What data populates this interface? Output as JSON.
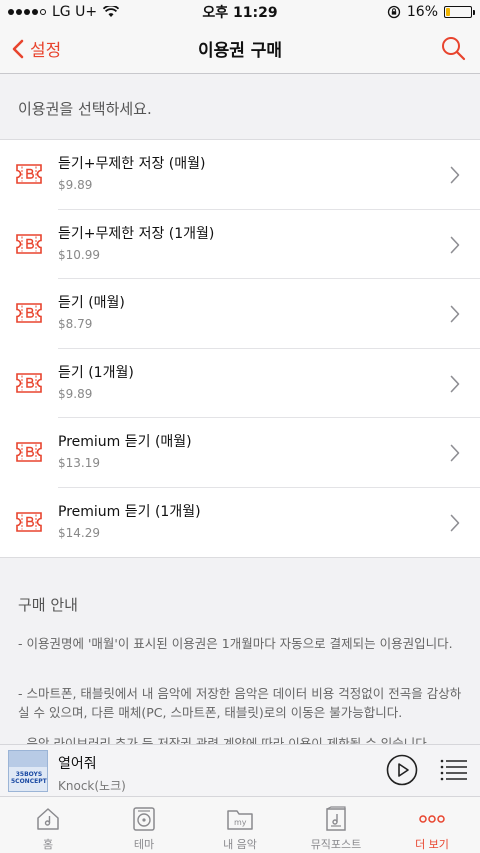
{
  "status_bar": {
    "carrier": "LG U+",
    "time": "오후 11:29",
    "battery": "16%",
    "battery_level": 0.16
  },
  "nav": {
    "back_label": "설정",
    "title": "이용권 구매"
  },
  "section_header": "이용권을 선택하세요.",
  "items": [
    {
      "title": "듣기+무제한 저장 (매월)",
      "price": "$9.89"
    },
    {
      "title": "듣기+무제한 저장 (1개월)",
      "price": "$10.99"
    },
    {
      "title": "듣기 (매월)",
      "price": "$8.79"
    },
    {
      "title": "듣기 (1개월)",
      "price": "$9.89"
    },
    {
      "title": "Premium 듣기 (매월)",
      "price": "$13.19"
    },
    {
      "title": "Premium 듣기 (1개월)",
      "price": "$14.29"
    }
  ],
  "info": {
    "title": "구매 안내",
    "lines": [
      "- 이용권명에 '매월'이 표시된 이용권은 1개월마다 자동으로 결제되는 이용권입니다.",
      "- 스마트폰, 태블릿에서 내 음악에 저장한 음악은 데이터 비용 걱정없이 전곡을 감상하실 수 있으며, 다른 매체(PC, 스마트폰, 태블릿)로의 이동은 불가능합니다.",
      "- 음악 라이브러리 추가 등 저작권 관련 계약에 따라 이용이 제한될 수 있습니다."
    ]
  },
  "player": {
    "song_title": "열어줘",
    "artist": "Knock(노크)",
    "album_art_text": "35BOYS 5CONCEPTS"
  },
  "tabs": [
    {
      "label": "홈",
      "icon": "home-icon"
    },
    {
      "label": "테마",
      "icon": "theme-icon"
    },
    {
      "label": "내 음악",
      "icon": "my-music-icon"
    },
    {
      "label": "뮤직포스트",
      "icon": "music-post-icon"
    },
    {
      "label": "더 보기",
      "icon": "more-icon"
    }
  ],
  "colors": {
    "accent": "#e8442e",
    "battery": "#f0b400"
  }
}
